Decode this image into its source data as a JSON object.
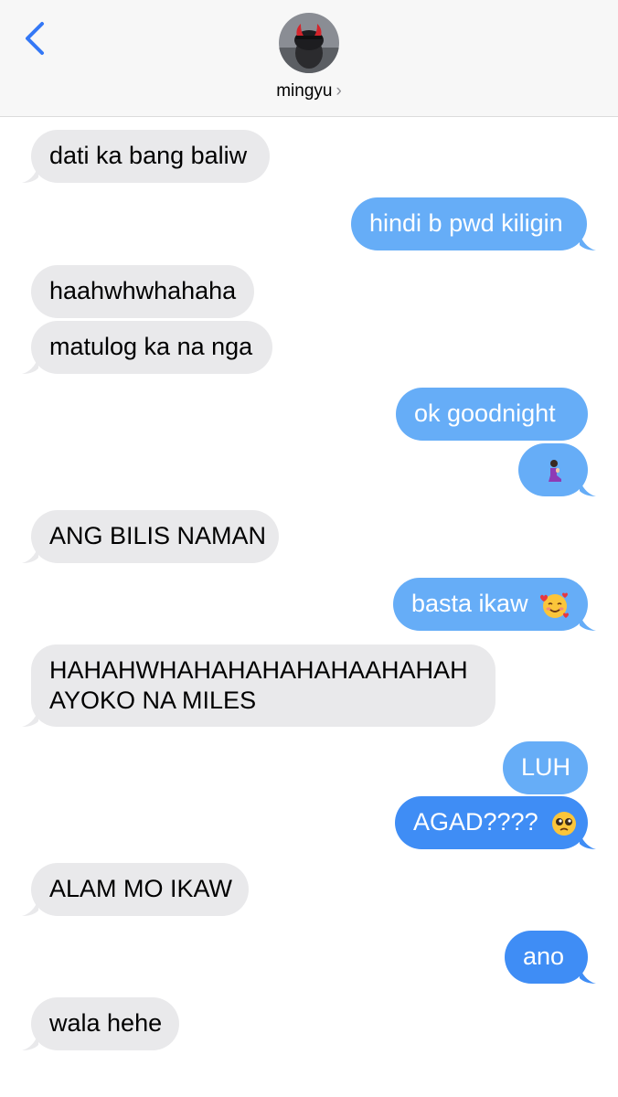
{
  "header": {
    "contact_name": "mingyu",
    "chevron": "›",
    "back_icon": "chevron-left-icon",
    "avatar_icon": "contact-avatar"
  },
  "colors": {
    "incoming_bubble": "#e9e9eb",
    "outgoing_bubble": "#66adf7",
    "outgoing_bubble_dark": "#3f8df5",
    "back_arrow": "#3478f6"
  },
  "messages": [
    {
      "direction": "in",
      "text": "dati ka bang baliw"
    },
    {
      "direction": "out",
      "text": "hindi b pwd kiligin"
    },
    {
      "direction": "in",
      "text": "haahwhwhahaha"
    },
    {
      "direction": "in",
      "text": "matulog ka na nga"
    },
    {
      "direction": "out",
      "text": "ok goodnight"
    },
    {
      "direction": "out",
      "text": "",
      "emoji": "praying-kneeling-person-emoji"
    },
    {
      "direction": "in",
      "text": "ANG BILIS NAMAN"
    },
    {
      "direction": "out",
      "text": "basta ikaw",
      "emoji": "smiling-face-with-hearts-emoji"
    },
    {
      "direction": "in",
      "text": "HAHAHWHAHAHAHAHAHAAHAHAH AYOKO NA MILES",
      "lines": [
        "HAHAHWHAHAHAHAHAHAAHAHAH",
        "AYOKO NA MILES"
      ]
    },
    {
      "direction": "out",
      "text": "LUH"
    },
    {
      "direction": "out",
      "text": "AGAD????",
      "emoji": "pleading-face-emoji"
    },
    {
      "direction": "in",
      "text": "ALAM MO IKAW"
    },
    {
      "direction": "out",
      "text": "ano"
    },
    {
      "direction": "in",
      "text": "wala hehe"
    }
  ]
}
